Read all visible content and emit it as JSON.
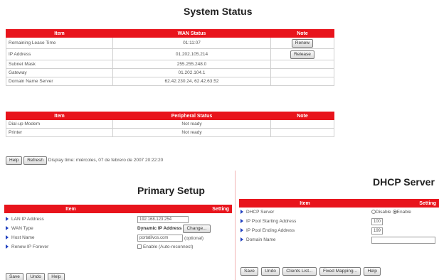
{
  "system_status": {
    "title": "System Status",
    "wan_table": {
      "headers": [
        "Item",
        "WAN Status",
        "Note"
      ],
      "rows": [
        {
          "item": "Remaining Lease Time",
          "value": "01:11:07"
        },
        {
          "item": "IP Address",
          "value": "01.202.105.214"
        },
        {
          "item": "Subnet Mask",
          "value": "255.255.248.0"
        },
        {
          "item": "Gateway",
          "value": "01.202.104.1"
        },
        {
          "item": "Domain Name Server",
          "value": "62.42.230.24, 62.42.63.52"
        }
      ],
      "renew_label": "Renew",
      "release_label": "Release"
    },
    "peripheral_table": {
      "headers": [
        "Item",
        "Peripheral Status",
        "Note"
      ],
      "rows": [
        {
          "item": "Dial-up Modem",
          "value": "Not ready"
        },
        {
          "item": "Printer",
          "value": "Not ready"
        }
      ]
    },
    "help_label": "Help",
    "refresh_label": "Refresh",
    "display_time": "Display time: miércoles, 07 de febrero de 2007 20:22:20"
  },
  "primary_setup": {
    "title": "Primary Setup",
    "headers": [
      "Item",
      "Setting"
    ],
    "lan_ip_label": "LAN IP Address",
    "lan_ip_value": "192.168.123.254",
    "wan_type_label": "WAN Type",
    "wan_type_value": "Dynamic IP Address",
    "change_label": "Change...",
    "host_name_label": "Host Name",
    "host_name_value": "portatilvos.com",
    "host_name_note": "(optional)",
    "renew_ip_label": "Renew IP Forever",
    "renew_ip_option": "Enable (Auto-reconnect)",
    "save_label": "Save",
    "undo_label": "Undo",
    "help_label": "Help"
  },
  "dhcp_server": {
    "title": "DHCP Server",
    "headers": [
      "Item",
      "Setting"
    ],
    "dhcp_server_label": "DHCP Server",
    "disable_label": "Disable",
    "enable_label": "Enable",
    "pool_start_label": "IP Pool Starting Address",
    "pool_start_value": "100",
    "pool_end_label": "IP Pool Ending Address",
    "pool_end_value": "199",
    "domain_name_label": "Domain Name",
    "domain_name_value": "",
    "save_label": "Save",
    "undo_label": "Undo",
    "clients_list_label": "Clients List...",
    "fixed_mapping_label": "Fixed Mapping...",
    "help_label": "Help"
  }
}
